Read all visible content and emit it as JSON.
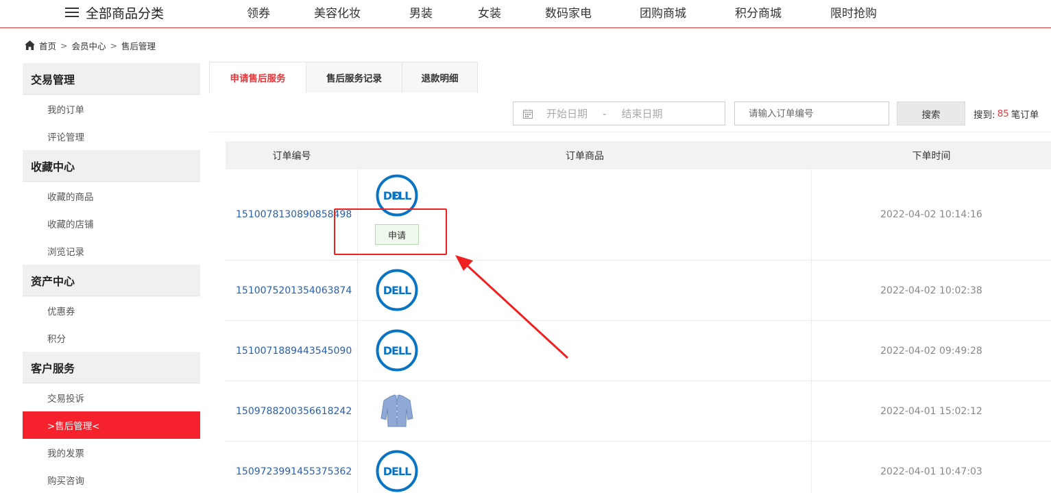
{
  "nav": {
    "all_categories": "全部商品分类",
    "links": [
      "领券",
      "美容化妆",
      "男装",
      "女装",
      "数码家电",
      "团购商城",
      "积分商城",
      "限时抢购"
    ]
  },
  "breadcrumb": [
    "首页",
    "会员中心",
    "售后管理"
  ],
  "sidebar": {
    "groups": [
      {
        "title": "交易管理",
        "items": [
          "我的订单",
          "评论管理"
        ]
      },
      {
        "title": "收藏中心",
        "items": [
          "收藏的商品",
          "收藏的店铺",
          "浏览记录"
        ]
      },
      {
        "title": "资产中心",
        "items": [
          "优惠券",
          "积分"
        ]
      },
      {
        "title": "客户服务",
        "items": [
          "交易投诉",
          ">售后管理<",
          "我的发票",
          "购买咨询"
        ]
      }
    ],
    "active_item": ">售后管理<"
  },
  "tabs": [
    {
      "label": "申请售后服务",
      "active": true
    },
    {
      "label": "售后服务记录",
      "active": false
    },
    {
      "label": "退款明细",
      "active": false
    }
  ],
  "filter": {
    "start_date_placeholder": "开始日期",
    "separator": "-",
    "end_date_placeholder": "结束日期",
    "order_placeholder": "请输入订单编号",
    "search_label": "搜索",
    "found_prefix": "搜到:",
    "found_count": "85",
    "found_suffix": "笔订单"
  },
  "table": {
    "headers": [
      "订单编号",
      "订单商品",
      "下单时间"
    ],
    "rows": [
      {
        "order_id": "1510078130890858498",
        "product": "dell-logo",
        "time": "2022-04-02 10:14:16",
        "action": "申请"
      },
      {
        "order_id": "1510075201354063874",
        "product": "dell-logo",
        "time": "2022-04-02 10:02:38"
      },
      {
        "order_id": "1510071889443545090",
        "product": "dell-logo",
        "time": "2022-04-02 09:49:28"
      },
      {
        "order_id": "1509788200356618242",
        "product": "shirt-thumbnail",
        "time": "2022-04-01 15:02:12"
      },
      {
        "order_id": "1509723991455375362",
        "product": "dell-logo",
        "time": "2022-04-01 10:47:03"
      }
    ]
  },
  "colors": {
    "brand_red": "#e4393c",
    "active_sidebar": "#f5222d",
    "link_blue": "#2a5fa8",
    "annotation_red": "#f02020",
    "dell_blue": "#0a74c4"
  }
}
